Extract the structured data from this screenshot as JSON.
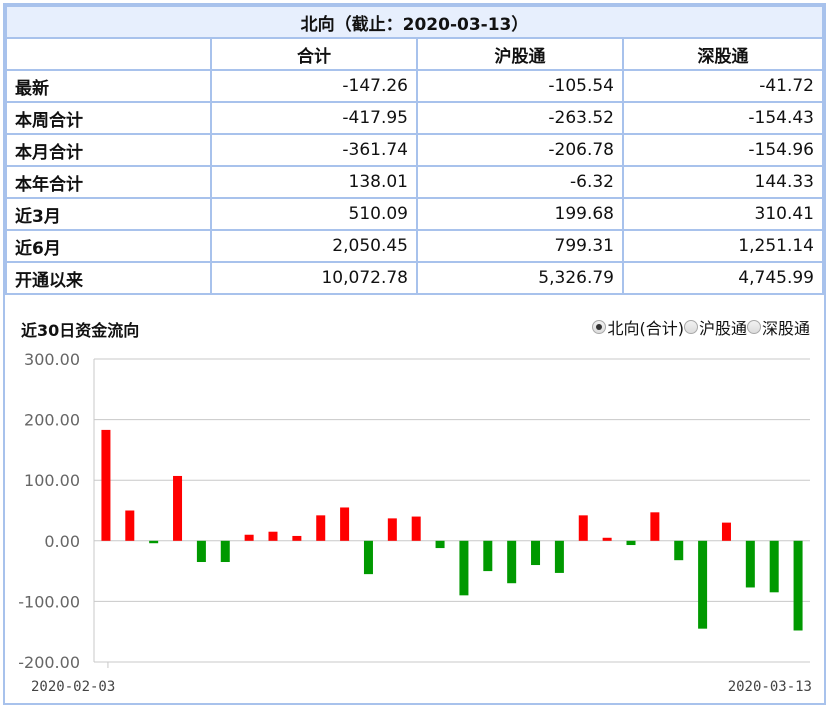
{
  "table": {
    "title": "北向（截止：2020-03-13）",
    "columns": [
      "",
      "合计",
      "沪股通",
      "深股通"
    ],
    "rows": [
      {
        "label": "最新",
        "values": [
          "-147.26",
          "-105.54",
          "-41.72"
        ]
      },
      {
        "label": "本周合计",
        "values": [
          "-417.95",
          "-263.52",
          "-154.43"
        ]
      },
      {
        "label": "本月合计",
        "values": [
          "-361.74",
          "-206.78",
          "-154.96"
        ]
      },
      {
        "label": "本年合计",
        "values": [
          "138.01",
          "-6.32",
          "144.33"
        ]
      },
      {
        "label": "近3月",
        "values": [
          "510.09",
          "199.68",
          "310.41"
        ]
      },
      {
        "label": "近6月",
        "values": [
          "2,050.45",
          "799.31",
          "1,251.14"
        ]
      },
      {
        "label": "开通以来",
        "values": [
          "10,072.78",
          "5,326.79",
          "4,745.99"
        ]
      }
    ]
  },
  "chart_title": "近30日资金流向",
  "radio_options": [
    {
      "label": "北向(合计)",
      "checked": true
    },
    {
      "label": "沪股通",
      "checked": false
    },
    {
      "label": "深股通",
      "checked": false
    }
  ],
  "colors": {
    "positive": "#ff0000",
    "negative": "#009900",
    "grid": "#c8c8c8",
    "border": "#a8c2ec"
  },
  "chart_data": {
    "type": "bar",
    "title": "近30日资金流向",
    "ylim": [
      -200,
      300
    ],
    "yticks": [
      "300.00",
      "200.00",
      "100.00",
      "0.00",
      "-100.00",
      "-200.00"
    ],
    "grid": true,
    "x_start_label": "2020-02-03",
    "x_end_label": "2020-03-13",
    "values": [
      183,
      50,
      -4,
      107,
      -35,
      -35,
      10,
      15,
      8,
      42,
      55,
      -55,
      37,
      40,
      -12,
      -90,
      -50,
      -70,
      -40,
      -53,
      42,
      5,
      -7,
      47,
      -32,
      -145,
      30,
      -77,
      -85,
      -148
    ]
  }
}
